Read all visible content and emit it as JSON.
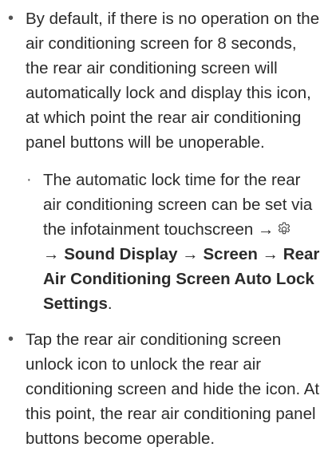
{
  "items": [
    {
      "text": "By default, if there is no operation on the air conditioning screen for 8 seconds, the rear air conditioning screen will automatically lock and display this icon, at which point the rear air conditioning panel buttons will be unoperable.",
      "sub_item": {
        "prefix": "The automatic lock time for the rear air conditioning screen can be set via the infotainment touchscreen →",
        "icon": "gear-settings-icon",
        "arrow": "→",
        "path": [
          "Sound Display",
          "Screen",
          "Rear Air Conditioning Screen Auto Lock Settings"
        ],
        "suffix": "."
      }
    },
    {
      "text": "Tap the rear air conditioning screen unlock icon to unlock the rear air conditioning screen and hide the icon. At this point, the rear air conditioning panel buttons become operable."
    }
  ],
  "bullet": "•",
  "sub_bullet": "·"
}
